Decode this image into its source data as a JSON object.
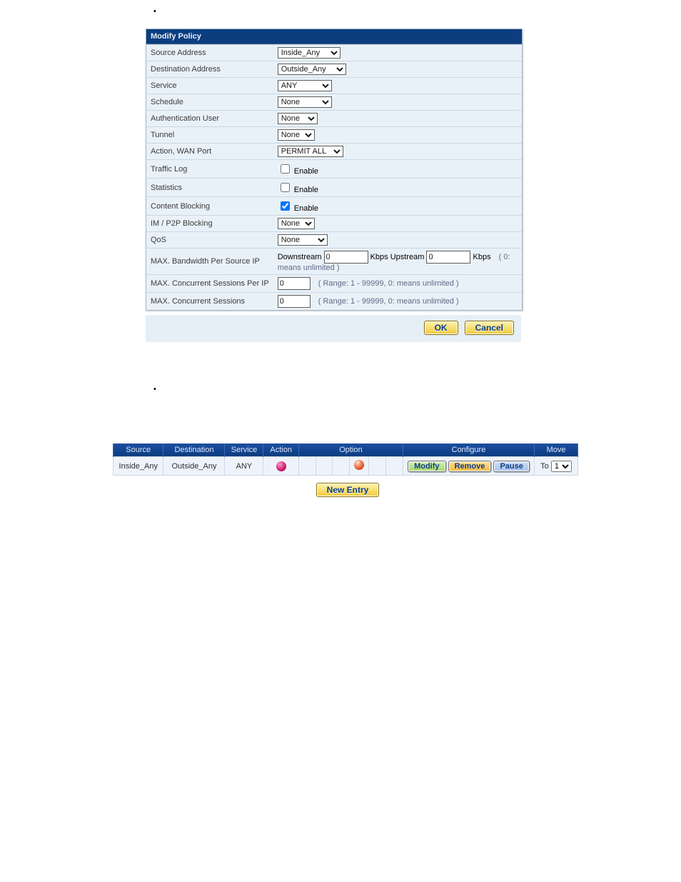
{
  "form": {
    "header": "Modify Policy",
    "labels": {
      "source": "Source Address",
      "dest": "Destination Address",
      "service": "Service",
      "schedule": "Schedule",
      "auth": "Authentication User",
      "tunnel": "Tunnel",
      "action": "Action, WAN Port",
      "traffic": "Traffic Log",
      "stats": "Statistics",
      "content": "Content Blocking",
      "imp2p": "IM / P2P Blocking",
      "qos": "QoS",
      "maxbw": "MAX. Bandwidth Per Source IP",
      "maxcspi": "MAX. Concurrent Sessions Per IP",
      "maxcs": "MAX. Concurrent Sessions",
      "enable": "Enable",
      "downstream": "Downstream",
      "upstream": "Kbps Upstream",
      "kbps_hint": "( 0: means unlimited )",
      "kbps": "Kbps",
      "range": "( Range: 1 - 99999, 0: means unlimited )"
    },
    "values": {
      "source": "Inside_Any",
      "dest": "Outside_Any",
      "service": "ANY",
      "schedule": "None",
      "auth": "None",
      "tunnel": "None",
      "action": "PERMIT ALL",
      "imp2p": "None",
      "qos": "None",
      "traffic_checked": false,
      "stats_checked": false,
      "content_checked": true,
      "down": "0",
      "up": "0",
      "cspi": "0",
      "cs": "0"
    },
    "buttons": {
      "ok": "OK",
      "cancel": "Cancel"
    }
  },
  "table": {
    "headers": {
      "source": "Source",
      "dest": "Destination",
      "service": "Service",
      "action": "Action",
      "option": "Option",
      "configure": "Configure",
      "move": "Move"
    },
    "row": {
      "source": "Inside_Any",
      "dest": "Outside_Any",
      "service": "ANY",
      "moveLabel": "To",
      "moveValue": "1"
    },
    "buttons": {
      "modify": "Modify",
      "remove": "Remove",
      "pause": "Pause",
      "new": "New Entry"
    }
  }
}
